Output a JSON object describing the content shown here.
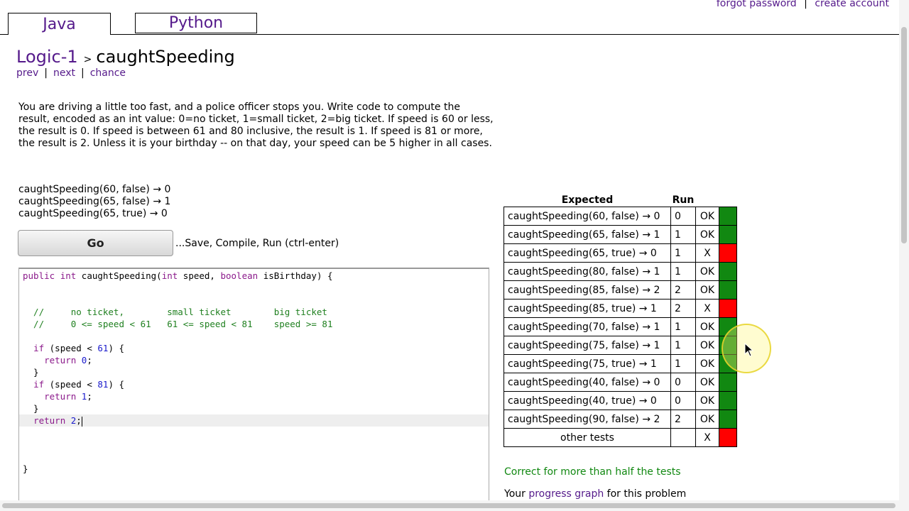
{
  "header": {
    "forgot_password": "forgot password",
    "separator": "|",
    "create_account": "create account"
  },
  "tabs": [
    {
      "label": "Java",
      "active": true
    },
    {
      "label": "Python",
      "active": false
    }
  ],
  "problem": {
    "category": "Logic-1",
    "breadcrumb_sep": ">",
    "name": "caughtSpeeding",
    "nav": {
      "prev": "prev",
      "next": "next",
      "chance": "chance",
      "sep": "|"
    },
    "description": "You are driving a little too fast, and a police officer stops you. Write code to compute the result, encoded as an int value: 0=no ticket, 1=small ticket, 2=big ticket. If speed is 60 or less, the result is 0. If speed is between 61 and 80 inclusive, the result is 1. If speed is 81 or more, the result is 2. Unless it is your birthday -- on that day, your speed can be 5 higher in all cases.",
    "examples": [
      "caughtSpeeding(60, false) → 0",
      "caughtSpeeding(65, false) → 1",
      "caughtSpeeding(65, true) → 0"
    ]
  },
  "go": {
    "label": "Go",
    "hint": "...Save, Compile, Run (ctrl-enter)"
  },
  "editor": {
    "lines": [
      "public int caughtSpeeding(int speed, boolean isBirthday) {",
      "",
      "",
      "  //     no ticket,        small ticket        big ticket",
      "  //     0 <= speed < 61   61 <= speed < 81    speed >= 81",
      "",
      "  if (speed < 61) {",
      "    return 0;",
      "  }",
      "  if (speed < 81) {",
      "    return 1;",
      "  }",
      "  return 2;",
      "",
      "",
      "",
      "}"
    ]
  },
  "results": {
    "header_expected": "Expected",
    "header_run": "Run",
    "rows": [
      {
        "expected": "caughtSpeeding(60, false) → 0",
        "run": "0",
        "status": "OK",
        "pass": true
      },
      {
        "expected": "caughtSpeeding(65, false) → 1",
        "run": "1",
        "status": "OK",
        "pass": true
      },
      {
        "expected": "caughtSpeeding(65, true) → 0",
        "run": "1",
        "status": "X",
        "pass": false
      },
      {
        "expected": "caughtSpeeding(80, false) → 1",
        "run": "1",
        "status": "OK",
        "pass": true
      },
      {
        "expected": "caughtSpeeding(85, false) → 2",
        "run": "2",
        "status": "OK",
        "pass": true
      },
      {
        "expected": "caughtSpeeding(85, true) → 1",
        "run": "2",
        "status": "X",
        "pass": false
      },
      {
        "expected": "caughtSpeeding(70, false) → 1",
        "run": "1",
        "status": "OK",
        "pass": true
      },
      {
        "expected": "caughtSpeeding(75, false) → 1",
        "run": "1",
        "status": "OK",
        "pass": true
      },
      {
        "expected": "caughtSpeeding(75, true) → 1",
        "run": "1",
        "status": "OK",
        "pass": true
      },
      {
        "expected": "caughtSpeeding(40, false) → 0",
        "run": "0",
        "status": "OK",
        "pass": true
      },
      {
        "expected": "caughtSpeeding(40, true) → 0",
        "run": "0",
        "status": "OK",
        "pass": true
      },
      {
        "expected": "caughtSpeeding(90, false) → 2",
        "run": "2",
        "status": "OK",
        "pass": true
      },
      {
        "expected": "other tests",
        "run": "",
        "status": "X",
        "pass": false
      }
    ],
    "summary": "Correct for more than half the tests",
    "progress_prefix": "Your",
    "progress_link": "progress graph",
    "progress_suffix": "for this problem"
  },
  "colors": {
    "pass": "#118811",
    "fail": "#ff0000",
    "link": "#551a8b"
  }
}
